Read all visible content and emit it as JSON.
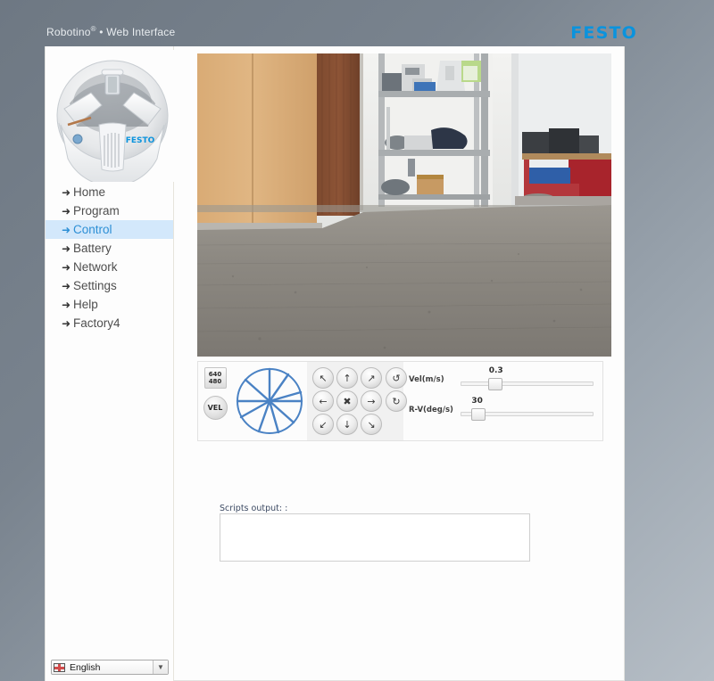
{
  "header": {
    "brand": "Robotino",
    "registered_mark": "®",
    "separator": " • ",
    "subtitle": "Web Interface",
    "logo_text": "FESTO",
    "logo_color": "#0b93dd"
  },
  "sidebar": {
    "robot_image_alt": "robotino-robot-photo",
    "robot_logo_text": "FESTO",
    "nav_items": [
      {
        "label": "Home",
        "arrow": "➜",
        "active": false
      },
      {
        "label": "Program",
        "arrow": "➜",
        "active": false
      },
      {
        "label": "Control",
        "arrow": "➜",
        "active": true
      },
      {
        "label": "Battery",
        "arrow": "➜",
        "active": false
      },
      {
        "label": "Network",
        "arrow": "➜",
        "active": false
      },
      {
        "label": "Settings",
        "arrow": "➜",
        "active": false
      },
      {
        "label": "Help",
        "arrow": "➜",
        "active": false
      },
      {
        "label": "Factory4",
        "arrow": "➜",
        "active": false
      }
    ],
    "language": {
      "selected": "English",
      "caret": "▼",
      "flag": "uk-flag-icon"
    }
  },
  "content": {
    "camera": {
      "name": "live-camera-feed",
      "resolution": "640x480",
      "scene": "office room with wooden cabinets, metal shelving, red sofa and grey carpet"
    },
    "control_panel": {
      "resolution_button": {
        "line1": "640",
        "line2": "480"
      },
      "vel_button": "VEL",
      "odometry_widget": "spoke-wheel",
      "dpad": [
        {
          "name": "move-up-left",
          "glyph": "↖"
        },
        {
          "name": "move-up",
          "glyph": "↑"
        },
        {
          "name": "move-up-right",
          "glyph": "↗"
        },
        {
          "name": "move-left",
          "glyph": "←"
        },
        {
          "name": "stop",
          "glyph": "✖"
        },
        {
          "name": "move-right",
          "glyph": "→"
        },
        {
          "name": "move-down-left",
          "glyph": "↙"
        },
        {
          "name": "move-down",
          "glyph": "↓"
        },
        {
          "name": "move-down-right",
          "glyph": "↘"
        }
      ],
      "rotation": [
        {
          "name": "rotate-counter-clockwise",
          "glyph": "↺"
        },
        {
          "name": "rotate-clockwise",
          "glyph": "↻"
        }
      ],
      "sliders": [
        {
          "label": "Vel(m/s)",
          "value": "0.3",
          "percent": 26
        },
        {
          "label": "R-V(deg/s)",
          "value": "30",
          "percent": 13
        }
      ]
    },
    "scripts": {
      "label": "Scripts output: :",
      "value": "",
      "placeholder": ""
    }
  }
}
